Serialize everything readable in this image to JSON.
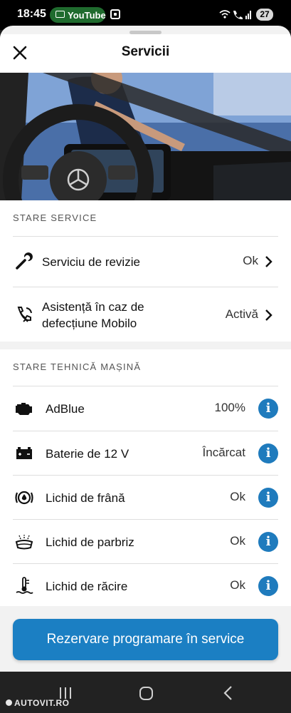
{
  "status_bar": {
    "time": "18:45",
    "youtube_pill": "YouTube",
    "battery": "27"
  },
  "header": {
    "title": "Servicii"
  },
  "service_status": {
    "heading": "STARE SERVICE",
    "items": [
      {
        "label": "Serviciu de revizie",
        "value": "Ok",
        "icon": "wrench-icon"
      },
      {
        "label": "Asistență în caz de defecțiune Mobilo",
        "value": "Activă",
        "icon": "phone-roadside-icon"
      }
    ]
  },
  "technical_status": {
    "heading": "STARE TEHNICĂ MAȘINĂ",
    "items": [
      {
        "label": "AdBlue",
        "value": "100%",
        "icon": "engine-icon"
      },
      {
        "label": "Baterie de 12 V",
        "value": "Încărcat",
        "icon": "battery-icon"
      },
      {
        "label": "Lichid de frână",
        "value": "Ok",
        "icon": "brake-fluid-icon"
      },
      {
        "label": "Lichid de parbriz",
        "value": "Ok",
        "icon": "washer-fluid-icon"
      },
      {
        "label": "Lichid de răcire",
        "value": "Ok",
        "icon": "coolant-icon"
      }
    ]
  },
  "cta": {
    "label": "Rezervare programare în service"
  },
  "watermark": "AUTOVIT.RO",
  "colors": {
    "accent": "#1b7fc3",
    "info": "#1f7bbd",
    "youtube_pill": "#1f6b2e"
  }
}
